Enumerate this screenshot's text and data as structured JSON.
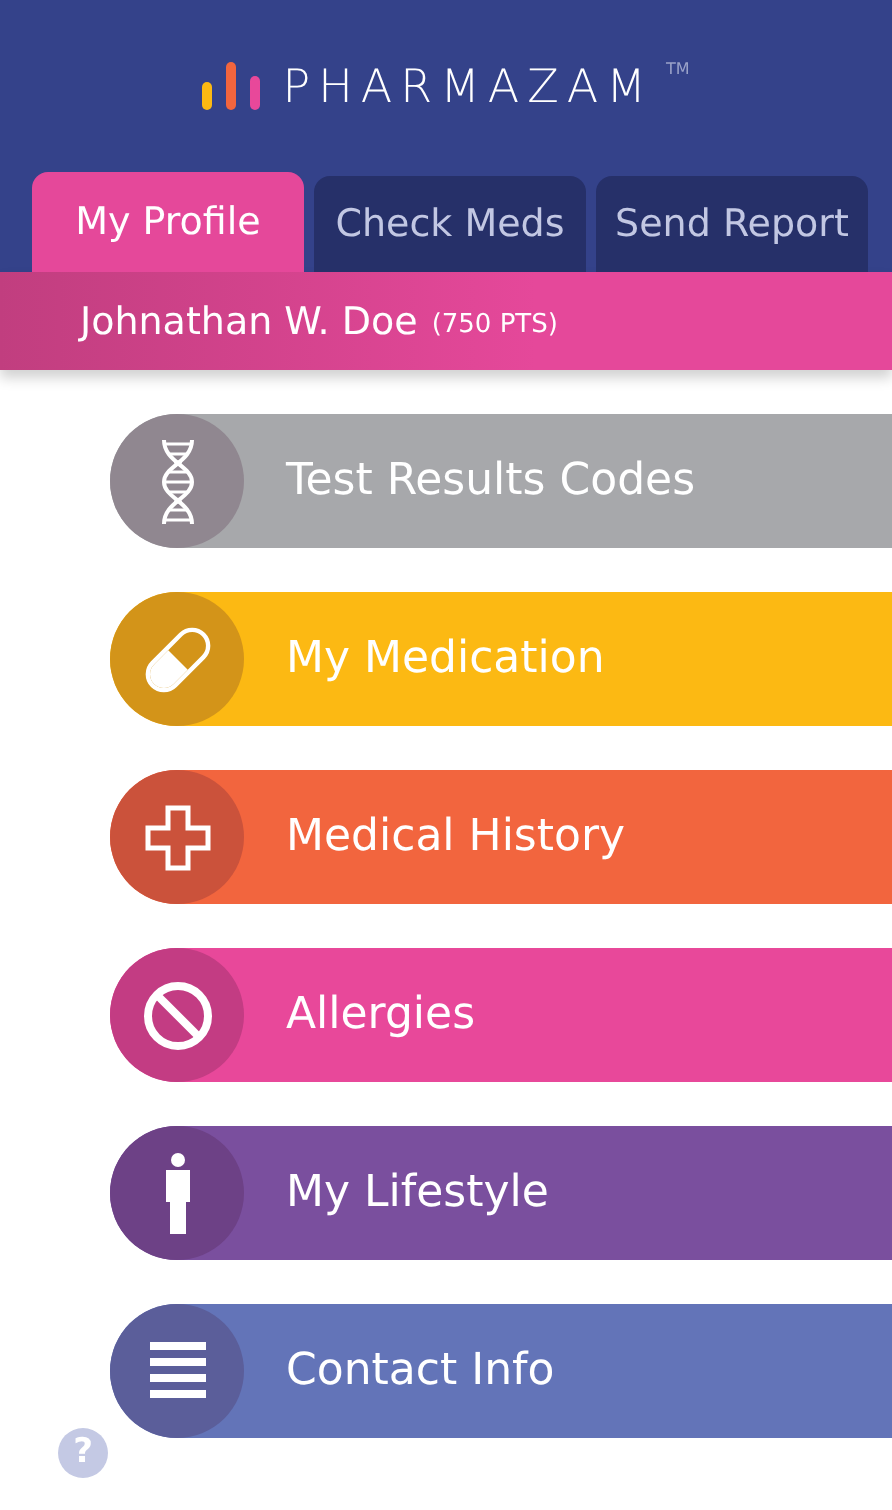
{
  "header": {
    "logo": "PHARMAZAM",
    "trademark": "TM"
  },
  "tabs": [
    {
      "label": "My Profile",
      "selected": true
    },
    {
      "label": "Check Meds",
      "selected": false
    },
    {
      "label": "Send Report",
      "selected": false
    }
  ],
  "profile": {
    "name": "Johnathan W. Doe",
    "points": "(750 PTS)"
  },
  "menu": [
    {
      "label": "Test Results Codes",
      "kind": "dna",
      "color": "#a7a8ab"
    },
    {
      "label": "My Medication",
      "kind": "pill",
      "color": "#fcb913"
    },
    {
      "label": "Medical History",
      "kind": "cross",
      "color": "#f2653e"
    },
    {
      "label": "Allergies",
      "kind": "forbidden",
      "color": "#e8489a"
    },
    {
      "label": "My Lifestyle",
      "kind": "person",
      "color": "#7a4f9e"
    },
    {
      "label": "Contact Info",
      "kind": "list",
      "color": "#6374b8"
    }
  ],
  "help": "?"
}
